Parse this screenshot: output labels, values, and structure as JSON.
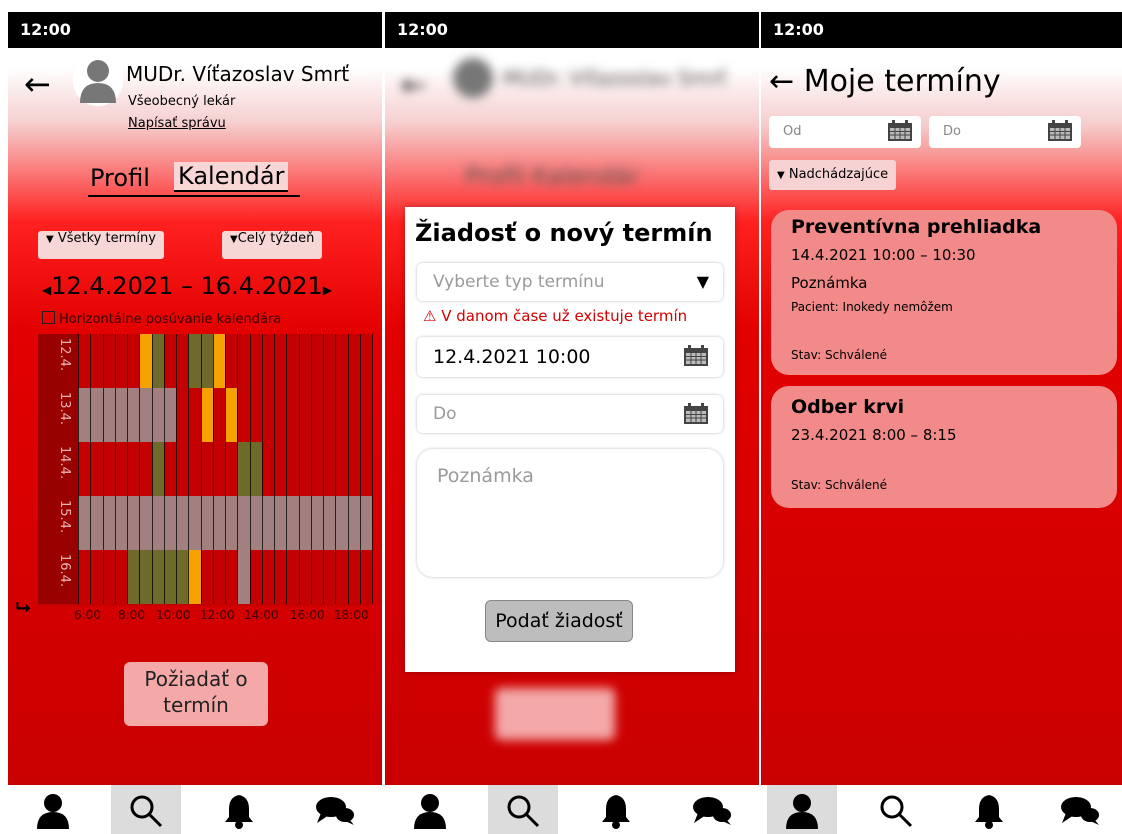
{
  "status_time": "12:00",
  "screen1": {
    "doctor_name": "MUDr. Víťazoslav Smrť",
    "doctor_role": "Všeobecný lekár",
    "message_link": "Napísať správu",
    "tab_profile": "Profil",
    "tab_calendar": "Kalendár",
    "filter_terms": "Všetky termíny",
    "filter_range": "Celý týždeň",
    "date_range": "12.4.2021 – 16.4.2021",
    "horizontal_scroll_label": "Horizontálne posúvanie kalendára",
    "day_labels": [
      "12.4.",
      "13.4.",
      "14.4.",
      "15.4.",
      "16.4."
    ],
    "time_ticks": [
      "6:00",
      "8:00",
      "10:00",
      "12:00",
      "14:00",
      "16:00",
      "18:00"
    ],
    "request_button": "Požiadať o termín"
  },
  "screen2": {
    "modal_title": "Žiadosť o nový termín",
    "type_placeholder": "Vyberte typ termínu",
    "warning": "V danom čase už existuje termín",
    "from_value": "12.4.2021 10:00",
    "to_placeholder": "Do",
    "note_placeholder": "Poznámka",
    "submit_button": "Podať žiadosť"
  },
  "screen3": {
    "title": "Moje termíny",
    "from_placeholder": "Od",
    "to_placeholder": "Do",
    "filter": "Nadchádzajúce",
    "appointments": [
      {
        "title": "Preventívna prehliadka",
        "time": "14.4.2021 10:00 – 10:30",
        "note": "Poznámka",
        "patient": "Pacient: Inokedy nemôžem",
        "status": "Stav: Schválené"
      },
      {
        "title": "Odber krvi",
        "time": "23.4.2021 8:00 – 8:15",
        "status": "Stav: Schválené"
      }
    ]
  },
  "colors": {
    "busy": "#a38080",
    "free": "#c40000",
    "available": "#6e6a2a",
    "selected": "#f5a200"
  },
  "nav_icons": [
    "person-icon",
    "search-icon",
    "bell-icon",
    "chat-icon"
  ]
}
